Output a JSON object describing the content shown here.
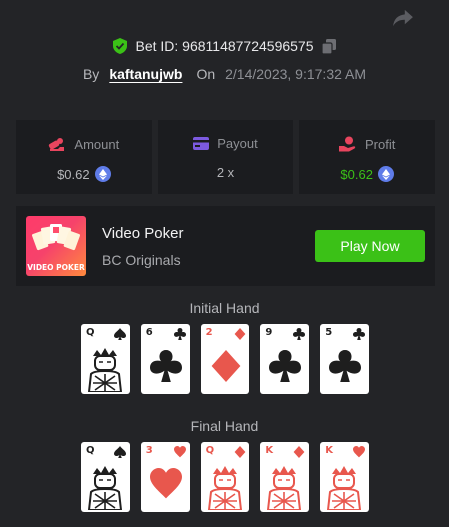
{
  "bet": {
    "label": "Bet ID:",
    "id": "96811487724596575",
    "by_label": "By",
    "user": "kaftanujwb",
    "on_label": "On",
    "date": "2/14/2023, 9:17:32 AM"
  },
  "stats": {
    "amount": {
      "label": "Amount",
      "value": "$0.62",
      "color": "#e8455e"
    },
    "payout": {
      "label": "Payout",
      "value": "2 x",
      "color": "#7c5ae0"
    },
    "profit": {
      "label": "Profit",
      "value": "$0.62",
      "color": "#e8455e",
      "value_color": "#3bc117"
    }
  },
  "game": {
    "thumb_title": "VIDEO POKER",
    "name": "Video Poker",
    "provider": "BC Originals",
    "play_label": "Play Now"
  },
  "initial_hand": {
    "title": "Initial Hand",
    "cards": [
      {
        "rank": "Q",
        "suit": "spades",
        "color": "black"
      },
      {
        "rank": "6",
        "suit": "clubs",
        "color": "black"
      },
      {
        "rank": "2",
        "suit": "diamonds",
        "color": "red"
      },
      {
        "rank": "9",
        "suit": "clubs",
        "color": "black"
      },
      {
        "rank": "5",
        "suit": "clubs",
        "color": "black"
      }
    ]
  },
  "final_hand": {
    "title": "Final Hand",
    "cards": [
      {
        "rank": "Q",
        "suit": "spades",
        "color": "black"
      },
      {
        "rank": "3",
        "suit": "hearts",
        "color": "red"
      },
      {
        "rank": "Q",
        "suit": "diamonds",
        "color": "red"
      },
      {
        "rank": "K",
        "suit": "diamonds",
        "color": "red"
      },
      {
        "rank": "K",
        "suit": "hearts",
        "color": "red"
      }
    ]
  },
  "colors": {
    "background": "#232427",
    "panel": "#1b1c1f",
    "accent_green": "#3bc117",
    "red_suit": "#e8574d"
  }
}
